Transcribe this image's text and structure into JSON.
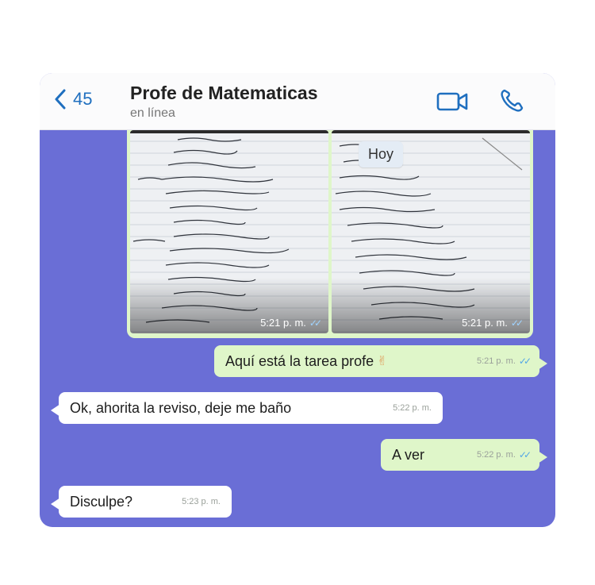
{
  "header": {
    "back_count": "45",
    "contact_name": "Profe de Matematicas",
    "contact_status": "en línea"
  },
  "icons": {
    "back": "chevron-left-icon",
    "video": "video-call-icon",
    "call": "phone-call-icon",
    "read_receipt": "double-check-icon"
  },
  "colors": {
    "chat_background": "#6a6ed6",
    "outgoing_bubble": "#dff6c9",
    "incoming_bubble": "#ffffff",
    "accent": "#1f6fbf",
    "read_ticks": "#53a7e6"
  },
  "chat": {
    "date_label": "Hoy",
    "media": [
      {
        "time": "5:21 p. m."
      },
      {
        "time": "5:21 p. m."
      }
    ],
    "messages": [
      {
        "direction": "out",
        "text": "Aquí está la tarea profe",
        "emoji": "✌",
        "time": "5:21 p. m."
      },
      {
        "direction": "in",
        "text": "Ok, ahorita la reviso, deje me baño",
        "time": "5:22 p. m."
      },
      {
        "direction": "out",
        "text": "A ver",
        "time": "5:22 p. m."
      },
      {
        "direction": "in",
        "text": "Disculpe?",
        "time": "5:23 p. m."
      }
    ]
  }
}
